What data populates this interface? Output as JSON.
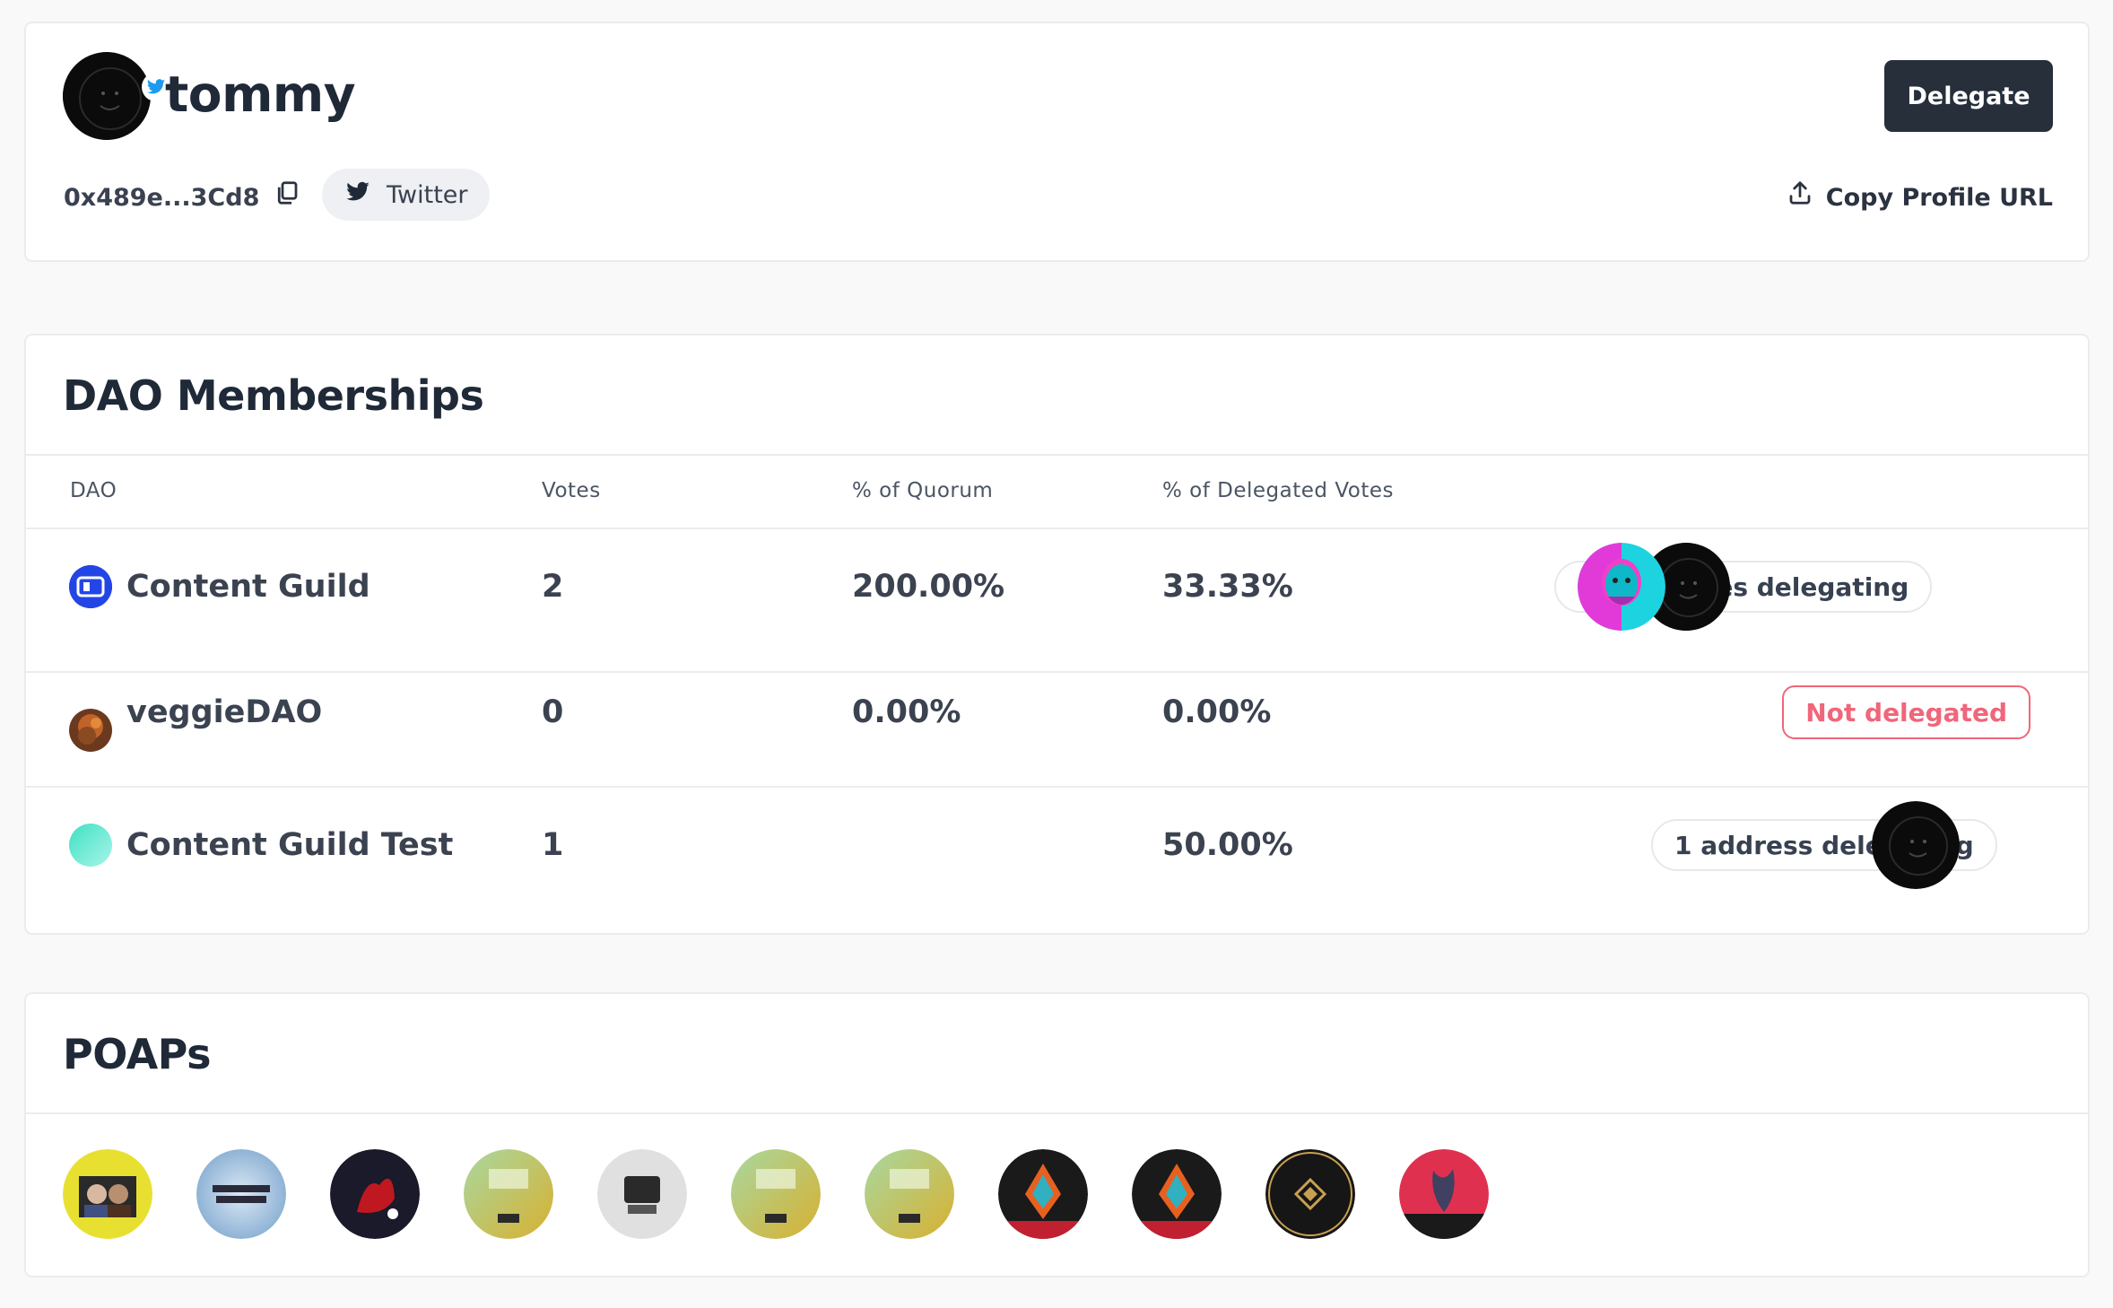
{
  "profile": {
    "name": "tommy",
    "address": "0x489e...3Cd8",
    "twitter_label": "Twitter",
    "delegate_label": "Delegate",
    "copy_url_label": "Copy Profile URL"
  },
  "daos": {
    "title": "DAO Memberships",
    "columns": [
      "DAO",
      "Votes",
      "% of Quorum",
      "% of Delegated Votes"
    ],
    "rows": [
      {
        "name": "Content Guild",
        "votes": "2",
        "quorum": "200.00%",
        "delegated": "33.33%",
        "status": "2 addresses delegating"
      },
      {
        "name": "veggieDAO",
        "votes": "0",
        "quorum": "0.00%",
        "delegated": "0.00%",
        "status": "Not delegated"
      },
      {
        "name": "Content Guild Test",
        "votes": "1",
        "quorum": "",
        "delegated": "50.00%",
        "status": "1 address delegating"
      }
    ]
  },
  "poaps": {
    "title": "POAPs",
    "items": [
      "poap-1",
      "poap-2",
      "poap-3",
      "poap-4",
      "poap-5",
      "poap-6",
      "poap-7",
      "poap-8",
      "poap-9",
      "poap-10",
      "poap-11"
    ]
  },
  "colors": {
    "primary_button": "#262f3a",
    "not_delegated": "#f0667a",
    "twitter_blue": "#1d9bf0"
  }
}
